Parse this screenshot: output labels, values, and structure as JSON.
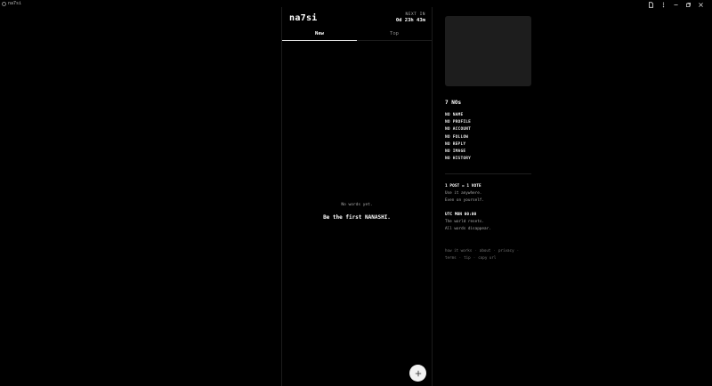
{
  "window": {
    "title": "na7si"
  },
  "feed": {
    "brand": "na7si",
    "timer_label": "NEXT IN",
    "timer_value": "0d 23h 43m",
    "tabs": [
      "New",
      "Top"
    ],
    "active_tab": "New",
    "empty_line1": "No words yet.",
    "empty_line2": "Be the first NANASHI.",
    "fab_icon": "plus-icon"
  },
  "sidebar": {
    "title": "7 NOs",
    "nos": [
      "NO NAME",
      "NO PROFILE",
      "NO ACCOUNT",
      "NO FOLLOW",
      "NO REPLY",
      "NO IMAGE",
      "NO HISTORY"
    ],
    "rule1_heading": "1 POST = 1 VOTE",
    "rule1_line1": "Use it anywhere.",
    "rule1_line2": "Even on yourself.",
    "rule2_heading": "UTC MON 00:00",
    "rule2_line1": "The world resets.",
    "rule2_line2": "All words disappear.",
    "footer": [
      "how it works",
      "about",
      "privacy",
      "terms",
      "tip",
      "copy url"
    ]
  },
  "colors": {
    "background": "#000000",
    "panel": "#1d1d1d",
    "text": "#e8e8e8",
    "muted": "#aaaaaa"
  }
}
